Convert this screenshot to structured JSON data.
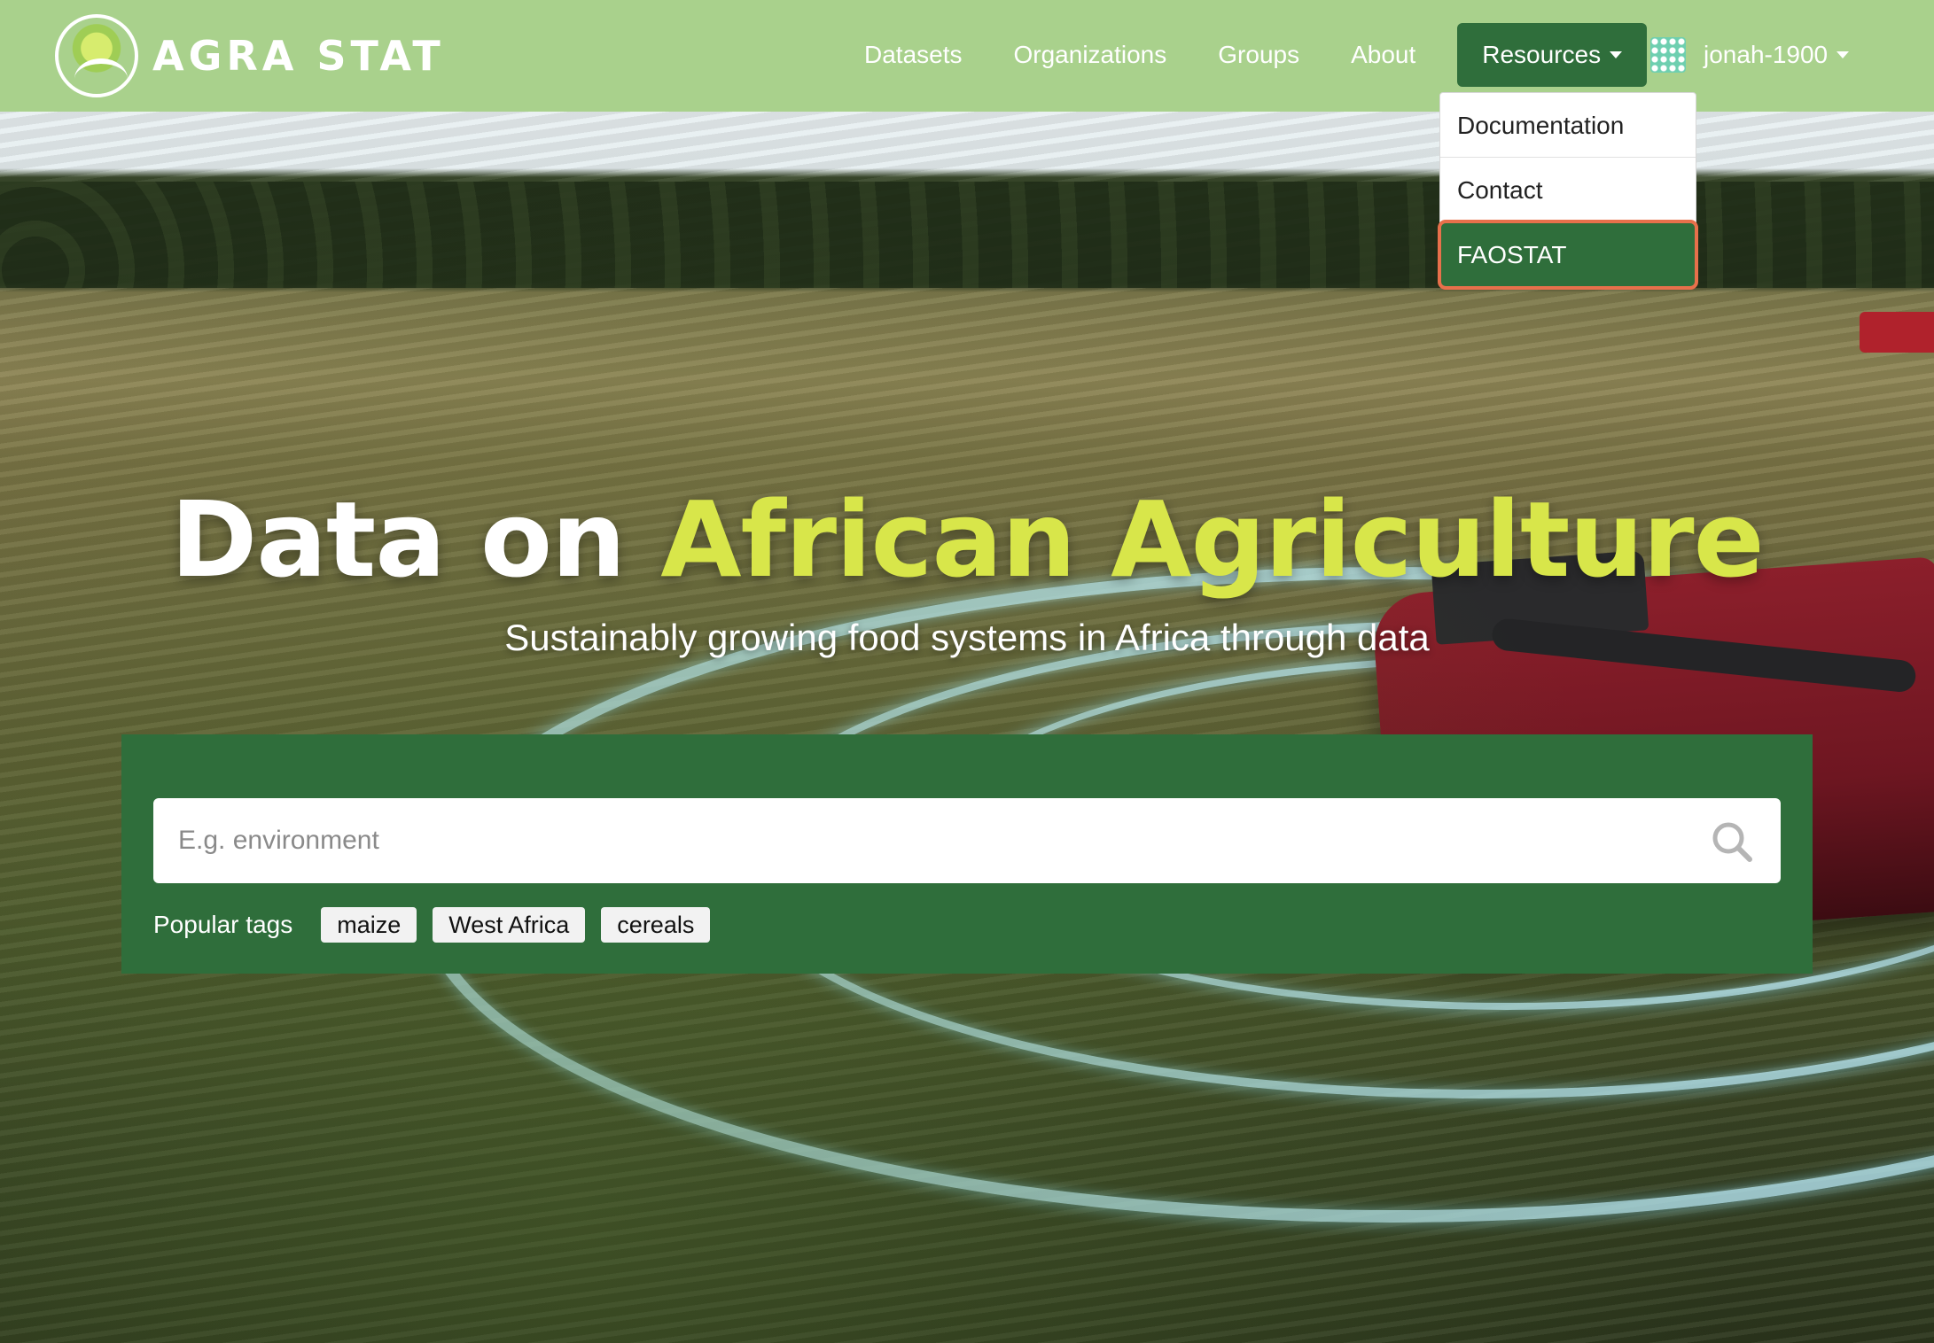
{
  "brand": {
    "name": "AGRA STAT"
  },
  "nav": {
    "links": [
      "Datasets",
      "Organizations",
      "Groups",
      "About"
    ],
    "resources_label": "Resources",
    "user_name": "jonah-1900"
  },
  "dropdown": {
    "items": [
      "Documentation",
      "Contact",
      "FAOSTAT"
    ],
    "selected": "FAOSTAT"
  },
  "hero": {
    "headline_plain": "Data on",
    "headline_accent": "African Agriculture",
    "subheadline": "Sustainably growing food systems in Africa through data"
  },
  "search": {
    "placeholder": "E.g. environment",
    "value": ""
  },
  "tags": {
    "label": "Popular tags",
    "items": [
      "maize",
      "West Africa",
      "cereals"
    ]
  },
  "colors": {
    "navbar": "#a9d18c",
    "primary_green": "#2f6e3b",
    "accent_yellow": "#d8e64a",
    "focus_outline": "#e8704b"
  }
}
